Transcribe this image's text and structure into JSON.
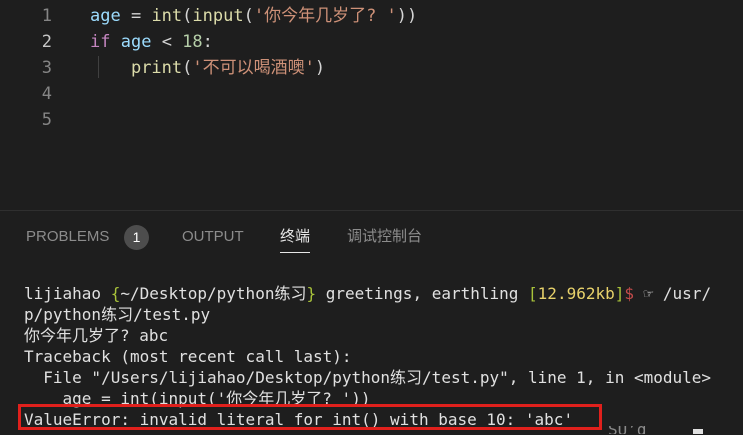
{
  "editor": {
    "lines": [
      {
        "num": "1",
        "tokens": [
          {
            "t": "age",
            "c": "var"
          },
          {
            "t": " = ",
            "c": "op"
          },
          {
            "t": "int",
            "c": "fn"
          },
          {
            "t": "(",
            "c": "op"
          },
          {
            "t": "input",
            "c": "fn"
          },
          {
            "t": "(",
            "c": "op"
          },
          {
            "t": "'你今年几岁了? '",
            "c": "str"
          },
          {
            "t": "))",
            "c": "op"
          }
        ]
      },
      {
        "num": "2",
        "active": true,
        "tokens": [
          {
            "t": "if",
            "c": "kw"
          },
          {
            "t": " ",
            "c": "op"
          },
          {
            "t": "age",
            "c": "var"
          },
          {
            "t": " < ",
            "c": "op"
          },
          {
            "t": "18",
            "c": "num"
          },
          {
            "t": ":",
            "c": "op"
          }
        ]
      },
      {
        "num": "3",
        "tokens": [
          {
            "t": "    ",
            "c": "op"
          },
          {
            "t": "print",
            "c": "fn"
          },
          {
            "t": "(",
            "c": "op"
          },
          {
            "t": "'不可以喝酒噢'",
            "c": "str"
          },
          {
            "t": ")",
            "c": "op"
          }
        ]
      },
      {
        "num": "4",
        "tokens": []
      },
      {
        "num": "5",
        "tokens": []
      }
    ]
  },
  "panel": {
    "tabs": {
      "problems": "PROBLEMS",
      "problems_count": "1",
      "output": "OUTPUT",
      "terminal": "终端",
      "debug_console": "调试控制台"
    }
  },
  "terminal": {
    "prompt": {
      "user": "lijiahao",
      "open_brace": " {",
      "cwd": "~/Desktop/python练习",
      "close_brace": "}",
      "greeting": " greetings, earthling ",
      "open_bracket": "[",
      "mem": "12.962kb",
      "close_bracket": "]",
      "dollar": "$",
      "cmd": " ☞ /usr/"
    },
    "lines": [
      "p/python练习/test.py",
      "你今年几岁了? abc",
      "Traceback (most recent call last):",
      "  File \"/Users/lijiahao/Desktop/python练习/test.py\", line 1, in <module>",
      "    age = int(input('你今年几岁了? '))",
      "ValueError: invalid literal for int() with base 10: 'abc'"
    ],
    "cutoff_text": "SU’d "
  },
  "colors": {
    "background": "#1e1e1e",
    "error_box": "#e0201c"
  }
}
